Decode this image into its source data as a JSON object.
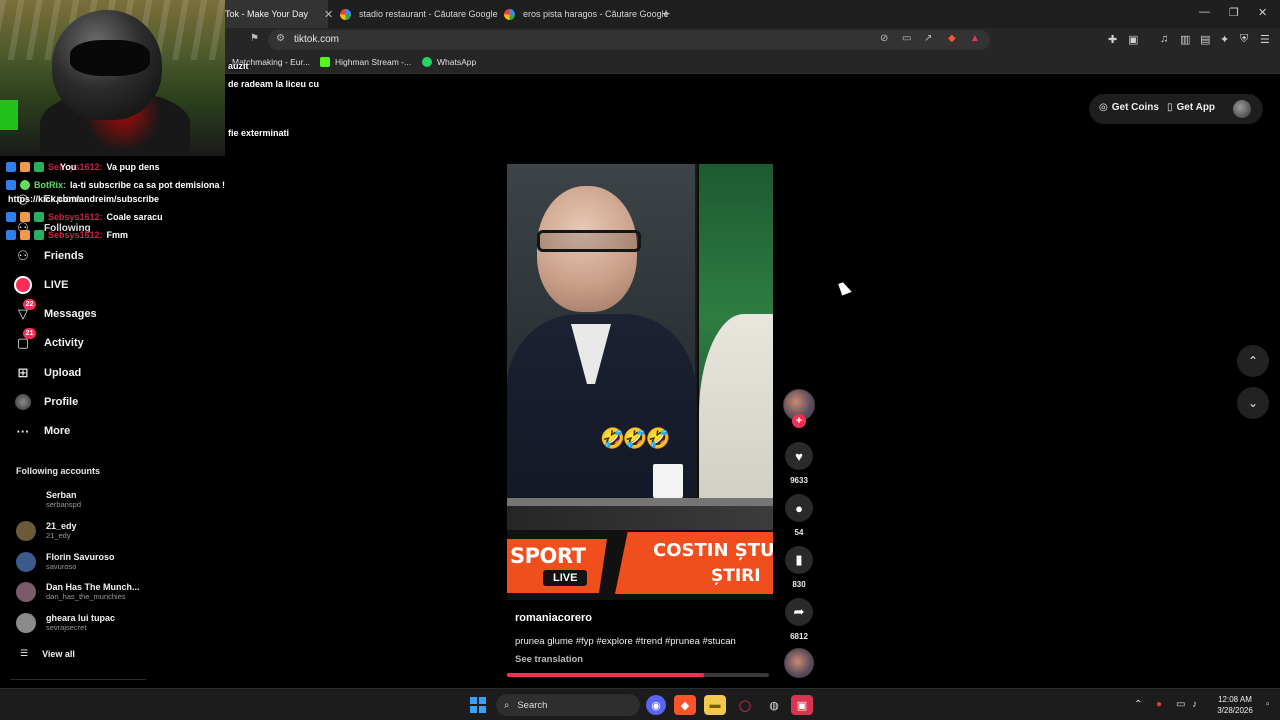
{
  "browser": {
    "tabs": [
      {
        "label": "Tok - Make Your Day",
        "active": true
      },
      {
        "label": "stadio restaurant - Căutare Google",
        "active": false
      },
      {
        "label": "eros pista haragos - Căutare Google",
        "active": false
      }
    ],
    "url": "tiktok.com",
    "bookmarks": [
      {
        "label": "Matchmaking - Eur...",
        "color": "#e0e0e0"
      },
      {
        "label": "Highman Stream -...",
        "color": "#53fc18"
      },
      {
        "label": "WhatsApp",
        "color": "#25d366"
      }
    ]
  },
  "stream_overlay": {
    "top_text_1": "auzit",
    "top_text_2": "de radeam la liceu cu",
    "top_text_3": "fie exterminati",
    "link_text": "https://kick.com/andreim/subscribe",
    "chat": [
      {
        "user": "Sebsys1612:",
        "message": "Va pup dens",
        "bot": false
      },
      {
        "user": "BotRix:",
        "message": "la-ti subscribe ca sa pot demisiona !",
        "bot": true
      },
      {
        "user": "Sebsys1612:",
        "message": "Coale saracu",
        "bot": false
      },
      {
        "user": "Sebsys1612:",
        "message": "Fmm",
        "bot": false
      }
    ]
  },
  "sidebar": {
    "partial_items": {
      "for_you": "You",
      "explore": "Explore",
      "following": "Following"
    },
    "items": [
      {
        "label": "Friends",
        "icon": "friends-icon"
      },
      {
        "label": "LIVE",
        "icon": "live-icon"
      },
      {
        "label": "Messages",
        "icon": "messages-icon",
        "badge": "22"
      },
      {
        "label": "Activity",
        "icon": "activity-icon",
        "badge": "21"
      },
      {
        "label": "Upload",
        "icon": "upload-icon"
      },
      {
        "label": "Profile",
        "icon": "profile-icon"
      },
      {
        "label": "More",
        "icon": "more-icon"
      }
    ],
    "following_title": "Following accounts",
    "accounts": [
      {
        "name": "Serban",
        "handle": "serbanspd",
        "color": "#000000"
      },
      {
        "name": "21_edy",
        "handle": "21_edy",
        "color": "#6b5a3a"
      },
      {
        "name": "Florin Savuroso",
        "handle": "savuroso",
        "color": "#3b5a8a"
      },
      {
        "name": "Dan Has The Munch...",
        "handle": "dan_has_the_munchies",
        "color": "#7a5a6a"
      },
      {
        "name": "gheara lui tupac",
        "handle": "sevrajsecret",
        "color": "#8a8a8a"
      }
    ],
    "view_all": "View all"
  },
  "header": {
    "get_coins": "Get Coins",
    "get_app": "Get App"
  },
  "video": {
    "emojis": "🤣🤣🤣",
    "banner_left": "SPORT",
    "banner_live": "LIVE",
    "banner_title": "COSTIN ȘTUC",
    "banner_sub": "ȘTIRI",
    "author": "romaniacorero",
    "caption": "prunea glume #fyp #explore #trend #prunea #stucan",
    "see_translation": "See translation",
    "progress": 0.75
  },
  "actions": {
    "likes": "9633",
    "comments": "54",
    "saves": "830",
    "shares": "6812"
  },
  "taskbar": {
    "search_placeholder": "Search",
    "time": "12:08 AM",
    "date": "3/28/2026"
  }
}
